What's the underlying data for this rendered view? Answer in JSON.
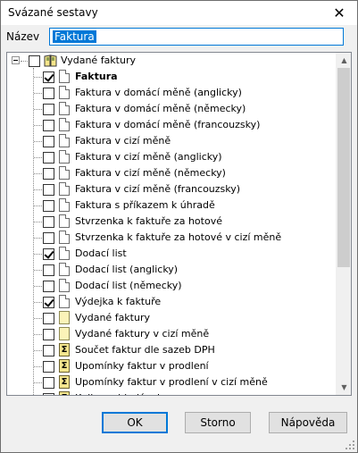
{
  "window": {
    "title": "Svázané sestavy"
  },
  "name_field": {
    "label": "Název",
    "value": "Faktura"
  },
  "tree": {
    "root": {
      "label": "Vydané faktury",
      "icon": "book-icon",
      "checked": false
    },
    "items": [
      {
        "label": "Faktura",
        "checked": true,
        "icon": "doc-icon",
        "bold": true
      },
      {
        "label": "Faktura v domácí měně (anglicky)",
        "checked": false,
        "icon": "doc-icon"
      },
      {
        "label": "Faktura v domácí měně (německy)",
        "checked": false,
        "icon": "doc-icon"
      },
      {
        "label": "Faktura v domácí měně (francouzsky)",
        "checked": false,
        "icon": "doc-icon"
      },
      {
        "label": "Faktura v cizí měně",
        "checked": false,
        "icon": "doc-icon"
      },
      {
        "label": "Faktura v cizí měně (anglicky)",
        "checked": false,
        "icon": "doc-icon"
      },
      {
        "label": "Faktura v cizí měně (německy)",
        "checked": false,
        "icon": "doc-icon"
      },
      {
        "label": "Faktura v cizí měně (francouzsky)",
        "checked": false,
        "icon": "doc-icon"
      },
      {
        "label": "Faktura s příkazem k úhradě",
        "checked": false,
        "icon": "doc-icon"
      },
      {
        "label": "Stvrzenka k faktuře za hotové",
        "checked": false,
        "icon": "doc-icon"
      },
      {
        "label": "Stvrzenka k faktuře za hotové v cizí měně",
        "checked": false,
        "icon": "doc-icon"
      },
      {
        "label": "Dodací list",
        "checked": true,
        "icon": "doc-icon"
      },
      {
        "label": "Dodací list (anglicky)",
        "checked": false,
        "icon": "doc-icon"
      },
      {
        "label": "Dodací list (německy)",
        "checked": false,
        "icon": "doc-icon"
      },
      {
        "label": "Výdejka k faktuře",
        "checked": true,
        "icon": "doc-icon"
      },
      {
        "label": "Vydané faktury",
        "checked": false,
        "icon": "yellow-doc-icon"
      },
      {
        "label": "Vydané faktury v cizí měně",
        "checked": false,
        "icon": "yellow-doc-icon"
      },
      {
        "label": "Součet faktur dle sazeb DPH",
        "checked": false,
        "icon": "sum-icon"
      },
      {
        "label": "Upomínky faktur v prodlení",
        "checked": false,
        "icon": "sum-icon"
      },
      {
        "label": "Upomínky faktur v prodlení v cizí měně",
        "checked": false,
        "icon": "sum-icon"
      },
      {
        "label": "Kniha pohledávek",
        "checked": false,
        "icon": "sum-icon"
      }
    ]
  },
  "buttons": {
    "ok": "OK",
    "cancel": "Storno",
    "help": "Nápověda"
  },
  "icons": {
    "close": "close-icon",
    "scroll_up": "arrow-up-icon",
    "scroll_down": "arrow-down-icon"
  },
  "colors": {
    "accent": "#0078d7",
    "selection": "#0078d7"
  }
}
